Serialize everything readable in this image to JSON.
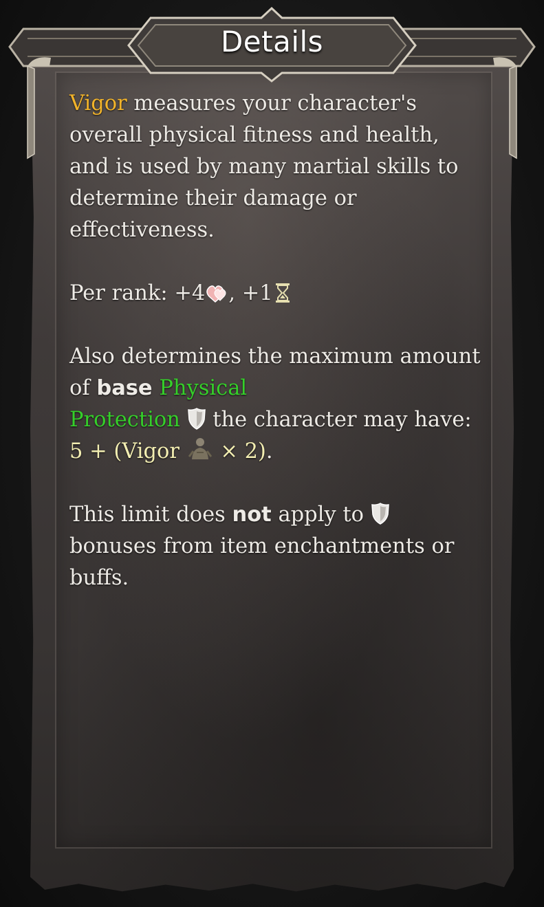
{
  "window": {
    "title": "Details"
  },
  "description": {
    "attribute_name": "Vigor",
    "intro_text": " measures your character's overall physical fitness and health, and is used by many martial skills to determine their damage or effectiveness.",
    "per_rank_label": "Per rank: ",
    "per_rank_health": "+4",
    "per_rank_separator": ", ",
    "per_rank_ap": "+1",
    "limit_text_1": "Also determines the maximum amount of ",
    "limit_bold": "base",
    "limit_space": " ",
    "protection_name_1": "Physical",
    "protection_name_2": "Protection",
    "limit_text_2": " the character may have: ",
    "formula_1": "5 + (Vigor ",
    "formula_2": " × 2)",
    "formula_end": ".",
    "note_text_1": "This limit does ",
    "note_bold": "not",
    "note_text_2": " apply to ",
    "note_text_3": " bonuses from item enchantments or buffs."
  },
  "icons": {
    "health": "hearts-icon",
    "action_points": "hourglass-icon",
    "protection": "shield-icon",
    "vigor": "vigor-figure-icon"
  },
  "colors": {
    "attribute_highlight": "#f1b32a",
    "protection_highlight": "#35cf2a",
    "formula_highlight": "#f3eeb2"
  }
}
